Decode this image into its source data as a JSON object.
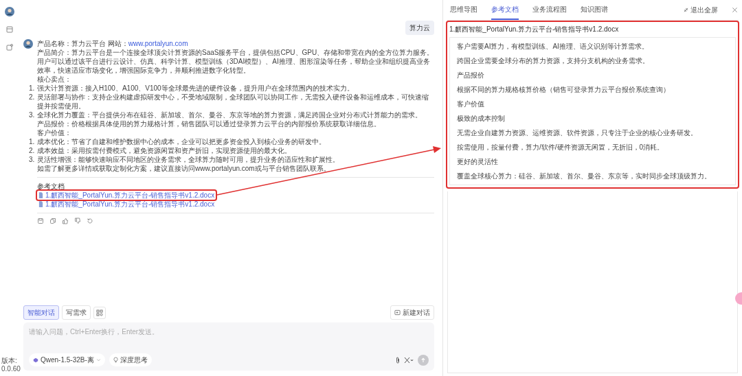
{
  "sidebar": {
    "version_label": "版本:",
    "version": "0.0.60"
  },
  "user_message": "算力云",
  "answer": {
    "lines": [
      {
        "kind": "title",
        "label": "产品名称：算力云平台 网站：",
        "link": "www.portalyun.com"
      },
      {
        "kind": "para",
        "text": "产品简介：算力云平台是一个连接全球顶尖计算资源的SaaS服务平台，提供包括CPU、GPU、存储和带宽在内的全方位算力服务。用户可以通过该平台进行云设计、仿真、科学计算、模型训练（3DAI模型）、AI推理、图形渲染等任务，帮助企业和组织提高业务效率，快速适应市场变化，增强国际竞争力，并顺利推进数字化转型。"
      },
      {
        "kind": "para",
        "text": "核心卖点："
      },
      {
        "kind": "item",
        "num": "1.",
        "text": "强大计算资源：接入H100、A100、V100等全球最先进的硬件设备，提升用户在全球范围内的技术实力。"
      },
      {
        "kind": "item",
        "num": "2.",
        "text": "灵活部署与协作：支持企业构建虚拟研发中心，不受地域限制，全球团队可以协同工作，无需投入硬件设备和运维成本，可快速缩提并按需使用。"
      },
      {
        "kind": "item",
        "num": "3.",
        "text": "全球化算力覆盖：平台提供分布在硅谷、新加坡、首尔、曼谷、东京等地的算力资源，满足跨国企业对分布式计算能力的需求。"
      },
      {
        "kind": "para",
        "text": "产品报价：价格根据具体使用的算力规格计算，销售团队可以通过登录算力云平台的内部报价系统获取详细信息。"
      },
      {
        "kind": "para",
        "text": "客户价值："
      },
      {
        "kind": "item",
        "num": "1.",
        "text": "成本优化：节省了自建和维护数据中心的成本，企业可以把更多资金投入到核心业务的研发中。"
      },
      {
        "kind": "item",
        "num": "2.",
        "text": "成本效益：采用按需付费模式，避免资源闲置和资产折旧，实现资源使用的最大化。"
      },
      {
        "kind": "item",
        "num": "3.",
        "text": "灵活性增强：能够快速响应不同地区的业务需求，全球算力随时可用，提升业务的适应性和扩展性。"
      },
      {
        "kind": "para",
        "text": "如需了解更多详情或获取定制化方案，建议直接访问www.portalyun.com或与平台销售团队联系。"
      }
    ],
    "references_title": "参考文档",
    "references": [
      {
        "name": "1.麒西智能_PortalYun.算力云平台-销售指导书v1.2.docx",
        "highlighted": true
      },
      {
        "name": "1.麒西智能_PortalYun.算力云平台-销售指导书v1.2.docx",
        "highlighted": false
      }
    ]
  },
  "composer": {
    "modes": [
      {
        "label": "智能对话",
        "selected": true
      },
      {
        "label": "写需求",
        "selected": false
      }
    ],
    "new_chat": "新建对话",
    "placeholder": "请输入问题，Ctrl+Enter换行，Enter发送。",
    "model": "Qwen-1.5-32B-离",
    "deep_think": "深度思考",
    "send_disabled": true
  },
  "panel": {
    "tabs": [
      {
        "label": "思维导图",
        "selected": false
      },
      {
        "label": "参考文档",
        "selected": true
      },
      {
        "label": "业务流程图",
        "selected": false
      },
      {
        "label": "知识图谱",
        "selected": false
      }
    ],
    "exit_fullscreen": "退出全屏",
    "doc_title": "1.麒西智能_PortalYun.算力云平台-销售指导书v1.2.docx",
    "highlighted": true,
    "paragraphs": [
      "客户需要AI算力，有模型训练、AI推理、语义识别等计算需求。",
      "跨国企业需要全球分布的算力资源，支持分支机构的业务需求。",
      "产品报价",
      "根据不同的算力规格核算价格（销售可登录算力云平台报价系统查询）",
      "客户价值",
      "极致的成本控制",
      "无需企业自建算力资源、运维资源、软件资源，只专注于企业的核心业务研发。",
      "按需使用，按量付费，算力/软件/硬件资源无闲置，无折旧，0消耗。",
      "更好的灵活性",
      "覆盖全球核心算力：硅谷、新加坡、首尔、曼谷、东京等，实时同步全球顶级算力。"
    ]
  }
}
